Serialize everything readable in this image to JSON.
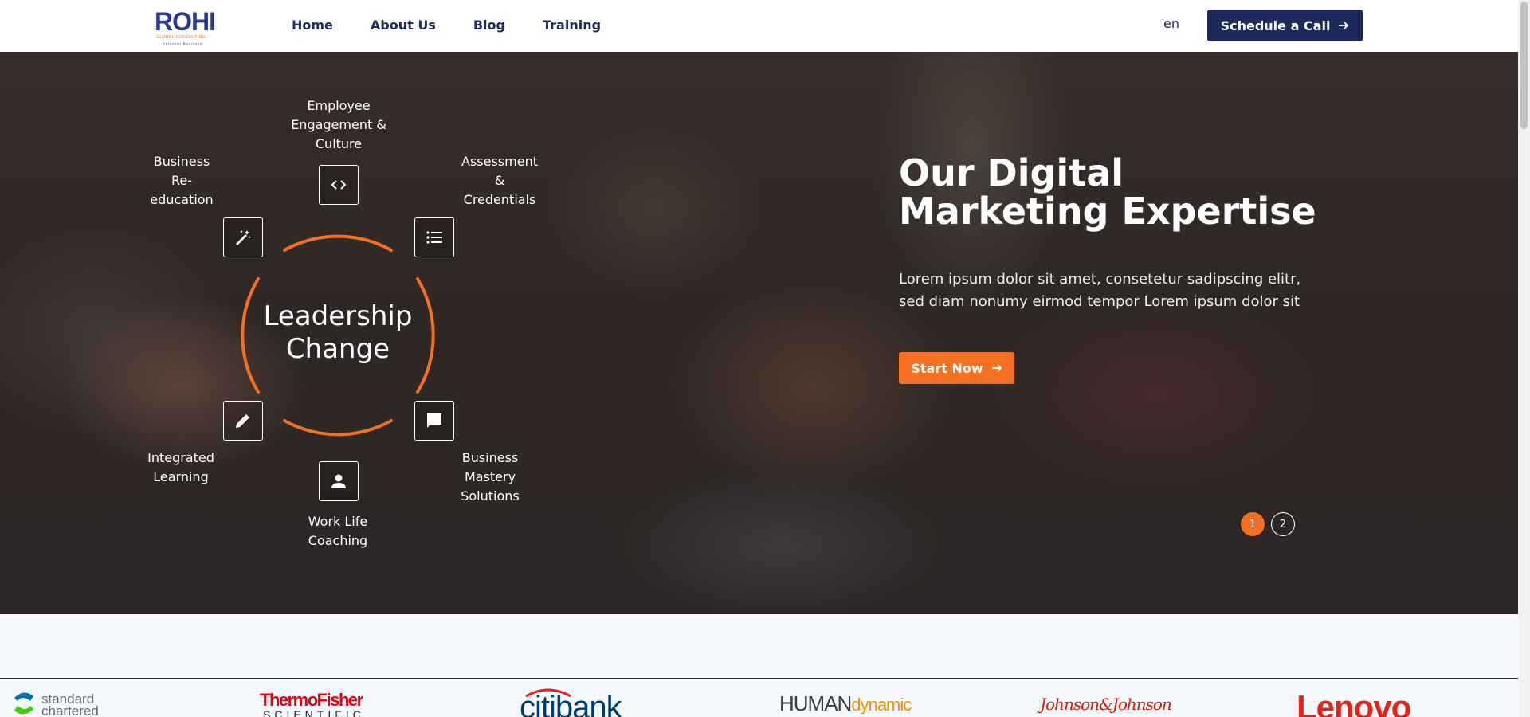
{
  "header": {
    "logo": {
      "word": "ROHI",
      "sub": "GLOBAL CONSULTING",
      "tag": "Reinvent Business"
    },
    "nav": [
      {
        "label": "Home"
      },
      {
        "label": "About Us"
      },
      {
        "label": "Blog"
      },
      {
        "label": "Training"
      }
    ],
    "language": "en",
    "cta_label": "Schedule a Call"
  },
  "hero": {
    "diagram": {
      "center_line1": "Leadership",
      "center_line2": "Change",
      "nodes": [
        {
          "id": "employee-engagement",
          "icon": "code-brackets-icon",
          "label": "Employee Engagement & Culture"
        },
        {
          "id": "assessment",
          "icon": "list-icon",
          "label": "Assessment & Credentials"
        },
        {
          "id": "business-mastery",
          "icon": "chat-bubble-icon",
          "label": "Business Mastery Solutions"
        },
        {
          "id": "work-life",
          "icon": "user-icon",
          "label": "Work Life Coaching"
        },
        {
          "id": "integrated-learning",
          "icon": "pencil-icon",
          "label": "Integrated Learning"
        },
        {
          "id": "business-reeducation",
          "icon": "magic-wand-icon",
          "label": "Business Re-education"
        }
      ]
    },
    "title_line1": "Our Digital",
    "title_line2": "Marketing Expertise",
    "text_line1": "Lorem ipsum dolor sit amet, consetetur sadipscing elitr,",
    "text_line2": "sed diam nonumy eirmod tempor Lorem ipsum dolor sit",
    "button_label": "Start Now",
    "pagination": [
      "1",
      "2"
    ],
    "active_slide": 1
  },
  "clients": {
    "logos": [
      {
        "name": "standard chartered",
        "line1": "standard",
        "line2": "chartered"
      },
      {
        "name": "Thermo Fisher Scientific",
        "line1": "ThermoFisher",
        "line2": "SCIENTIFIC"
      },
      {
        "name": "citibank",
        "text": "citibank"
      },
      {
        "name": "HUMAN dynamic",
        "part1": "HUMAN",
        "part2": "dynamic"
      },
      {
        "name": "Johnson & Johnson",
        "text": "Johnson&Johnson"
      },
      {
        "name": "Lenovo",
        "text": "Lenovo"
      }
    ]
  },
  "colors": {
    "brand_navy": "#1e2a5e",
    "accent_orange": "#f36f21",
    "page_bg": "#f5f9fd"
  }
}
